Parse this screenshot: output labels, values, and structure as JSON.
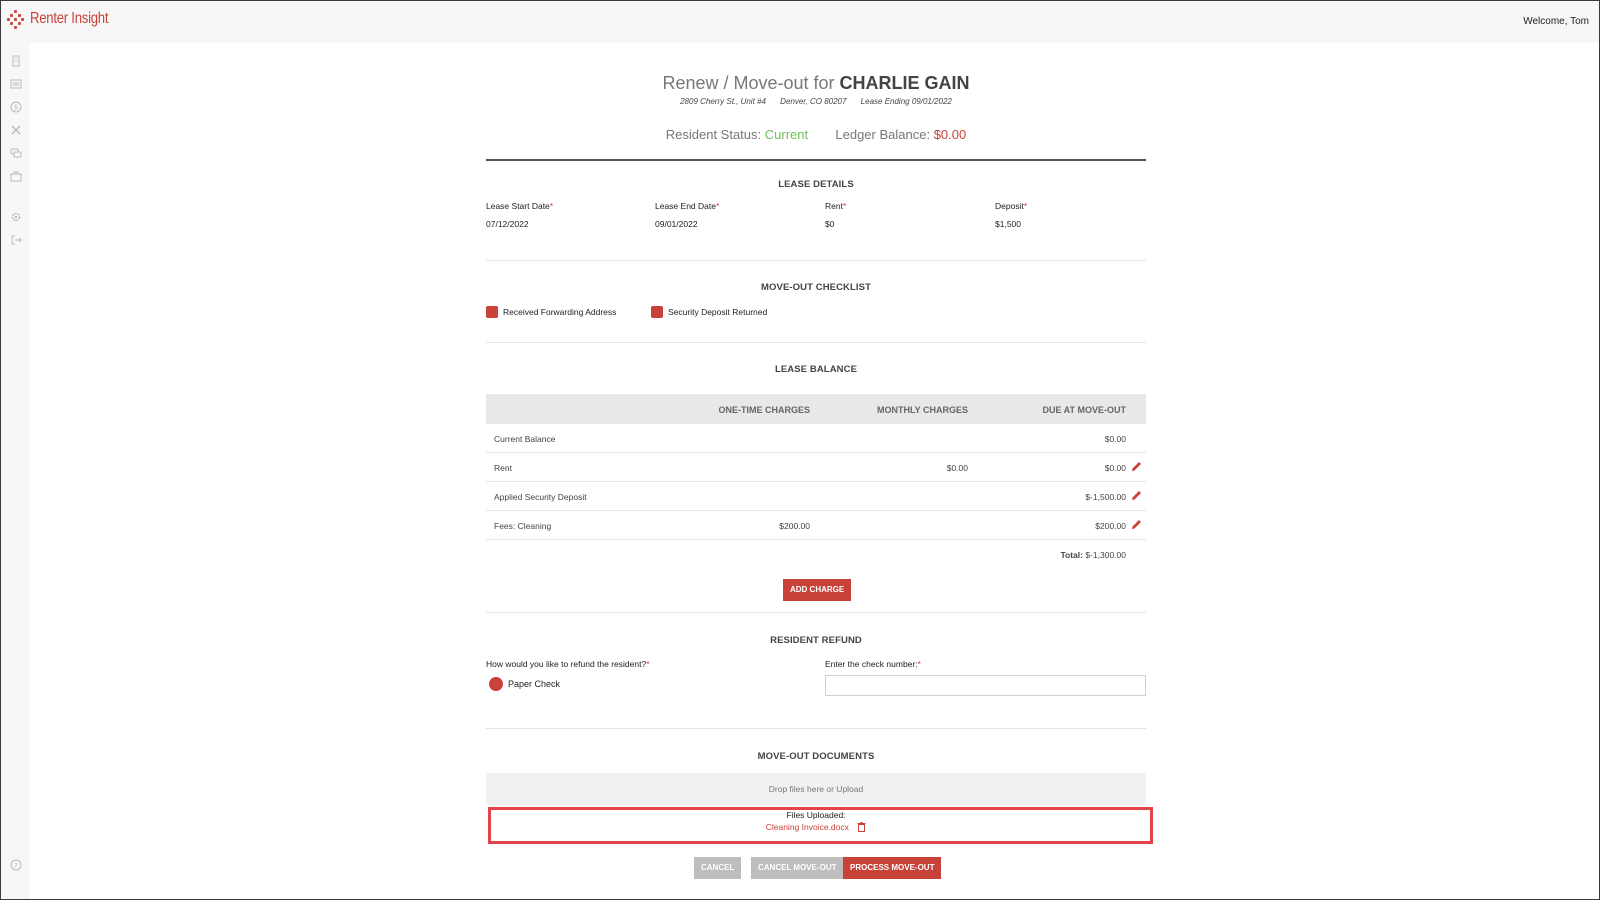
{
  "header": {
    "logo_text": "Renter Insight",
    "welcome": "Welcome, Tom"
  },
  "sidebar": {
    "icons": [
      "building-icon",
      "list-icon",
      "dollar-icon",
      "tools-icon",
      "chat-icon",
      "briefcase-icon",
      "gear-icon",
      "logout-icon",
      "help-icon"
    ]
  },
  "page": {
    "title_prefix": "Renew / Move-out for",
    "tenant_name": "CHARLIE GAIN",
    "address": "2809 Cherry St., Unit #4",
    "city": "Denver, CO 80207",
    "lease_ending": "Lease Ending 09/01/2022",
    "status_label": "Resident Status:",
    "status_value": "Current",
    "ledger_label": "Ledger Balance:",
    "ledger_value": "$0.00"
  },
  "lease_details": {
    "heading": "LEASE DETAILS",
    "start_label": "Lease Start Date",
    "start_value": "07/12/2022",
    "end_label": "Lease End Date",
    "end_value": "09/01/2022",
    "rent_label": "Rent",
    "rent_value": "$0",
    "deposit_label": "Deposit",
    "deposit_value": "$1,500",
    "required_mark": "*"
  },
  "checklist": {
    "heading": "MOVE-OUT CHECKLIST",
    "item1": "Received Forwarding Address",
    "item2": "Security Deposit Returned"
  },
  "lease_balance": {
    "heading": "LEASE BALANCE",
    "col_one_time": "ONE-TIME CHARGES",
    "col_monthly": "MONTHLY CHARGES",
    "col_due": "DUE AT MOVE-OUT",
    "rows": [
      {
        "label": "Current Balance",
        "one_time": "",
        "monthly": "",
        "due": "$0.00",
        "editable": false
      },
      {
        "label": "Rent",
        "one_time": "",
        "monthly": "$0.00",
        "due": "$0.00",
        "editable": true
      },
      {
        "label": "Applied Security Deposit",
        "one_time": "",
        "monthly": "",
        "due": "$-1,500.00",
        "editable": true
      },
      {
        "label": "Fees: Cleaning",
        "one_time": "$200.00",
        "monthly": "",
        "due": "$200.00",
        "editable": true
      }
    ],
    "total_label": "Total:",
    "total_value": "$-1,300.00",
    "add_charge": "ADD CHARGE"
  },
  "refund": {
    "heading": "RESIDENT REFUND",
    "question": "How would you like to refund the resident?",
    "option": "Paper Check",
    "check_label": "Enter the check number:",
    "check_value": ""
  },
  "documents": {
    "heading": "MOVE-OUT DOCUMENTS",
    "drop_text": "Drop files here or Upload",
    "uploaded_label": "Files Uploaded:",
    "file_name": "Cleaning Invoice.docx"
  },
  "footer": {
    "cancel": "CANCEL",
    "cancel_move_out": "CANCEL MOVE-OUT",
    "process": "PROCESS MOVE-OUT"
  },
  "colors": {
    "accent": "#c8423a",
    "status_green": "#6cbf5a",
    "highlight": "#e2444c"
  }
}
